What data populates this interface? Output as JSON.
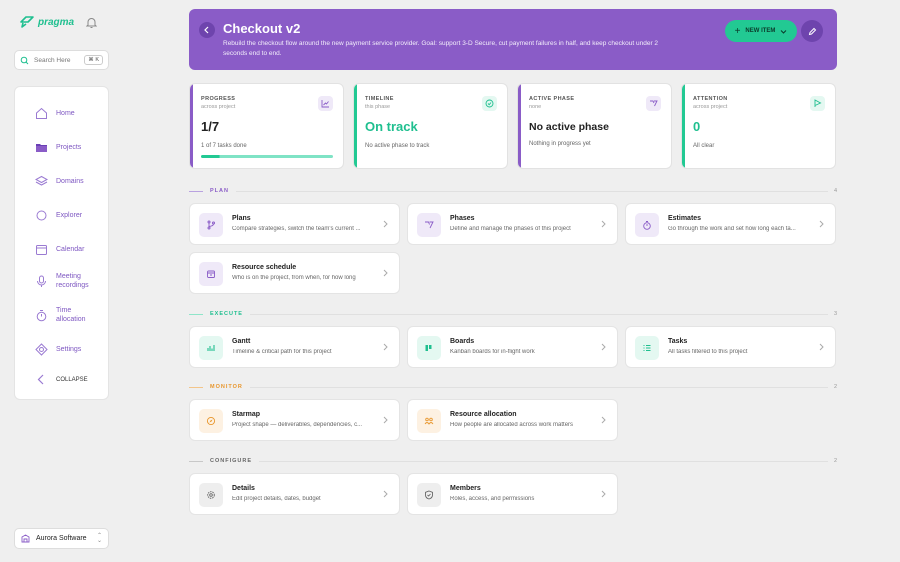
{
  "sidebar": {
    "logo": "pragma",
    "search": {
      "placeholder": "Search Here",
      "shortcut": "⌘ K"
    },
    "items": [
      {
        "label": "Home",
        "icon": "home-icon"
      },
      {
        "label": "Projects",
        "icon": "folder-icon"
      },
      {
        "label": "Domains",
        "icon": "layers-icon"
      },
      {
        "label": "Explorer",
        "icon": "search-icon"
      },
      {
        "label": "Calendar",
        "icon": "calendar-icon"
      },
      {
        "label": "Meeting recordings",
        "icon": "microphone-icon"
      },
      {
        "label": "Time allocation",
        "icon": "timer-icon"
      },
      {
        "label": "Settings",
        "icon": "gear-icon"
      }
    ],
    "collapse_label": "COLLAPSE",
    "org_name": "Aurora Software"
  },
  "header": {
    "title": "Checkout v2",
    "description": "Rebuild the checkout flow around the new payment service provider. Goal: support 3-D Secure, cut payment failures in half, and keep checkout under 2 seconds end to end.",
    "new_item_label": "NEW ITEM",
    "accent": "#8a5cc7"
  },
  "stats": [
    {
      "label": "PROGRESS",
      "sub": "across project",
      "value": "1/7",
      "note": "1 of 7 tasks done",
      "progress_fraction": 0.14,
      "color": "#8a5cc7",
      "icon": "chart-icon"
    },
    {
      "label": "TIMELINE",
      "sub": "this phase",
      "value": "On track",
      "note": "No active phase to track",
      "color": "#22c993",
      "icon": "check-circle-icon"
    },
    {
      "label": "ACTIVE PHASE",
      "sub": "none",
      "value": "No active phase",
      "note": "Nothing in progress yet",
      "color": "#8a5cc7",
      "icon": "phases-icon"
    },
    {
      "label": "ATTENTION",
      "sub": "across project",
      "value": "0",
      "note": "All clear",
      "color": "#22c993",
      "icon": "flag-icon"
    }
  ],
  "sections": [
    {
      "name": "PLAN",
      "count": "4",
      "color": "#8a5cc7"
    },
    {
      "name": "EXECUTE",
      "count": "3",
      "color": "#22c993"
    },
    {
      "name": "MONITOR",
      "count": "2",
      "color": "#e8962c"
    },
    {
      "name": "CONFIGURE",
      "count": "2",
      "color": "#777777"
    }
  ],
  "tiles": {
    "plans": {
      "title": "Plans",
      "desc": "Compare strategies, switch the team's current ..."
    },
    "phases": {
      "title": "Phases",
      "desc": "Define and manage the phases of this project"
    },
    "estimates": {
      "title": "Estimates",
      "desc": "Go through the work and set how long each ta..."
    },
    "resource_schedule": {
      "title": "Resource schedule",
      "desc": "Who is on the project, from when, for how long"
    },
    "gantt": {
      "title": "Gantt",
      "desc": "Timeline & critical path for this project"
    },
    "boards": {
      "title": "Boards",
      "desc": "Kanban boards for in-flight work"
    },
    "tasks": {
      "title": "Tasks",
      "desc": "All tasks filtered to this project"
    },
    "starmap": {
      "title": "Starmap",
      "desc": "Project shape — deliverables, dependencies, c..."
    },
    "resource_allocation": {
      "title": "Resource allocation",
      "desc": "How people are allocated across work matters"
    },
    "details": {
      "title": "Details",
      "desc": "Edit project details, dates, budget"
    },
    "members": {
      "title": "Members",
      "desc": "Roles, access, and permissions"
    }
  }
}
